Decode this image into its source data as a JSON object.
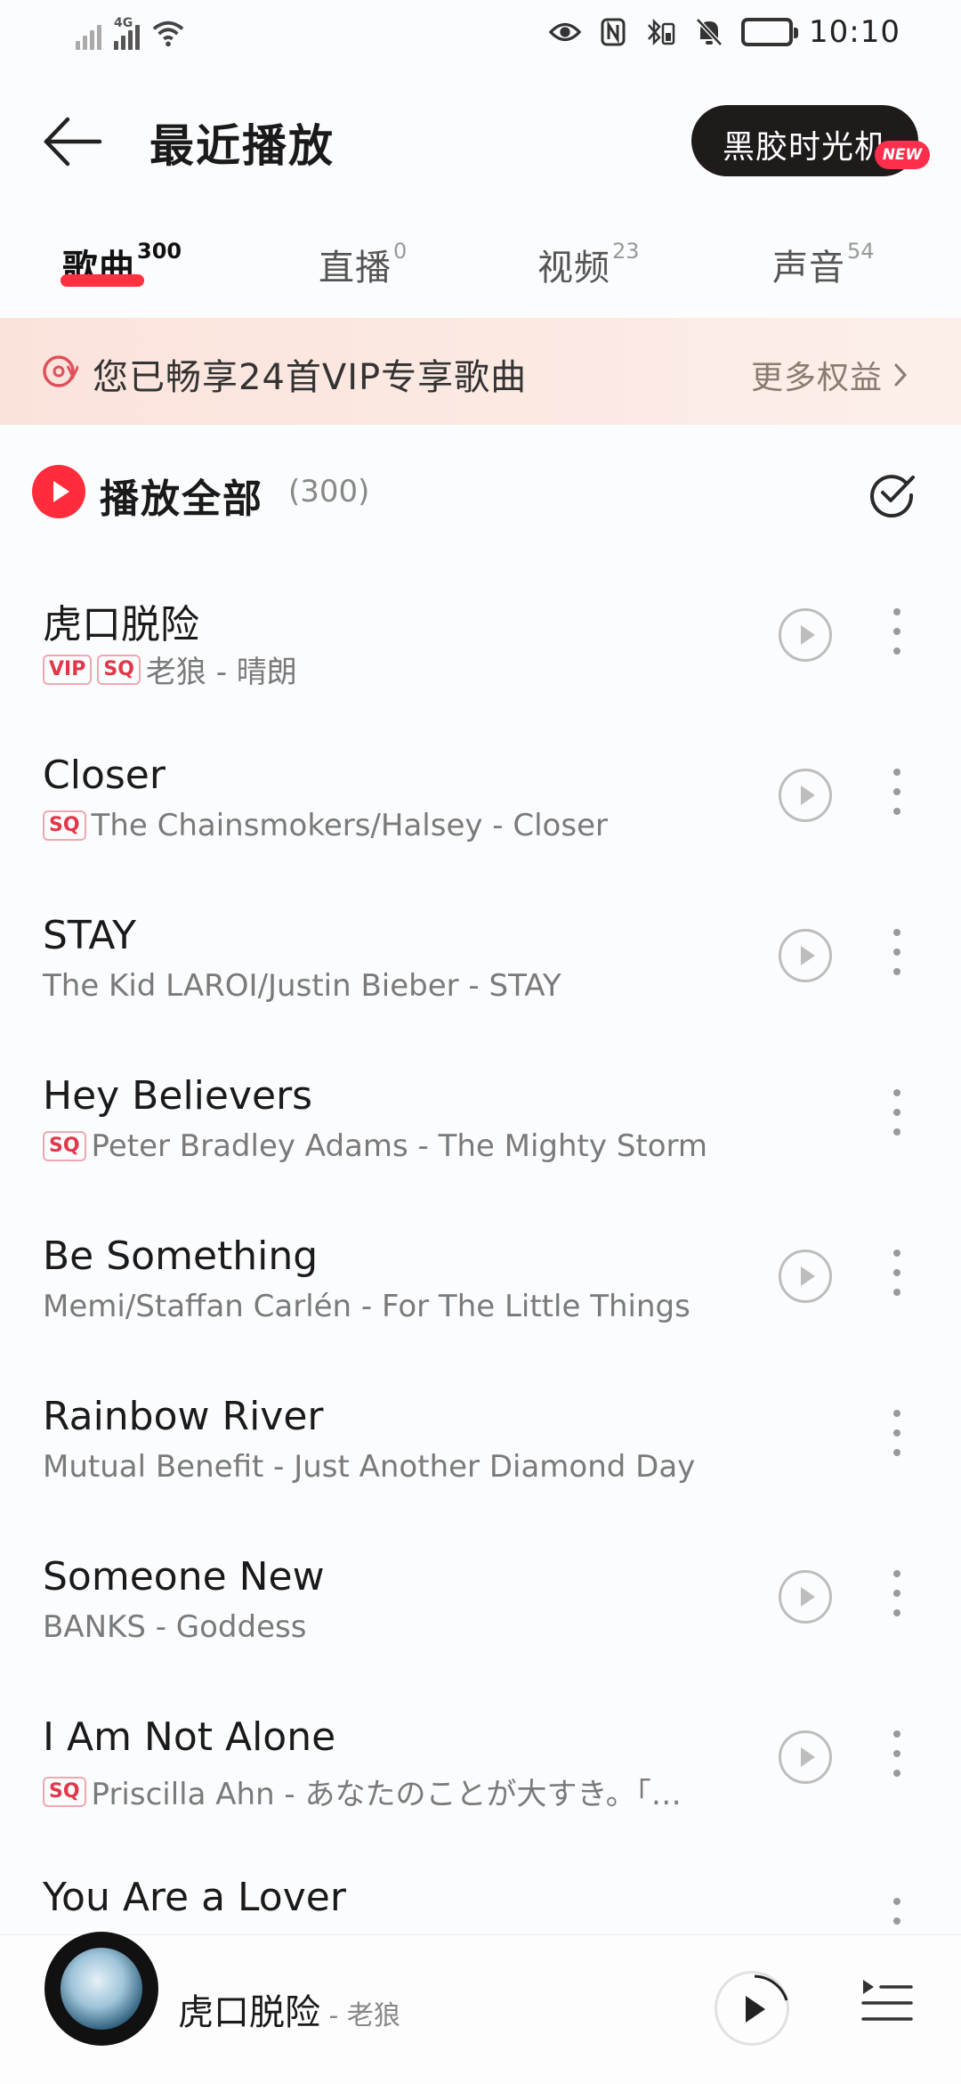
{
  "status_bar": {
    "time": "10:10",
    "network_label": "4G"
  },
  "header": {
    "title": "最近播放",
    "vinyl_button": "黑胶时光机",
    "new_badge": "NEW"
  },
  "tabs": [
    {
      "label": "歌曲",
      "count": "300",
      "active": true
    },
    {
      "label": "直播",
      "count": "0",
      "active": false
    },
    {
      "label": "视频",
      "count": "23",
      "active": false
    },
    {
      "label": "声音",
      "count": "54",
      "active": false
    }
  ],
  "vip_banner": {
    "text": "您已畅享24首VIP专享歌曲",
    "more": "更多权益"
  },
  "play_all": {
    "label": "播放全部",
    "count": "(300)"
  },
  "songs": [
    {
      "title": "虎口脱险",
      "badges": [
        "VIP",
        "SQ"
      ],
      "subtitle": "老狼 - 晴朗",
      "has_mv": true
    },
    {
      "title": "Closer",
      "badges": [
        "SQ"
      ],
      "subtitle": "The Chainsmokers/Halsey - Closer",
      "has_mv": true
    },
    {
      "title": "STAY",
      "badges": [],
      "subtitle": "The Kid LAROI/Justin Bieber - STAY",
      "has_mv": true
    },
    {
      "title": "Hey Believers",
      "badges": [
        "SQ"
      ],
      "subtitle": "Peter Bradley Adams - The Mighty Storm",
      "has_mv": false
    },
    {
      "title": "Be Something",
      "badges": [],
      "subtitle": "Memi/Staffan Carlén - For The Little Things",
      "has_mv": true
    },
    {
      "title": "Rainbow River",
      "badges": [],
      "subtitle": "Mutual Benefit - Just Another Diamond Day",
      "has_mv": false
    },
    {
      "title": "Someone New",
      "badges": [],
      "subtitle": "BANKS - Goddess",
      "has_mv": true
    },
    {
      "title": "I Am Not Alone",
      "badges": [
        "SQ"
      ],
      "subtitle": "Priscilla Ahn - あなたのことが大すき。「…",
      "has_mv": true
    },
    {
      "title": "You Are a Lover",
      "badges": [],
      "subtitle": "",
      "has_mv": false
    }
  ],
  "mini_player": {
    "title": "虎口脱险",
    "artist": " - 老狼"
  },
  "colors": {
    "accent": "#ff2c3c",
    "vinyl_button_bg": "#1f1b1b",
    "banner_bg": "#fbe3dc"
  }
}
